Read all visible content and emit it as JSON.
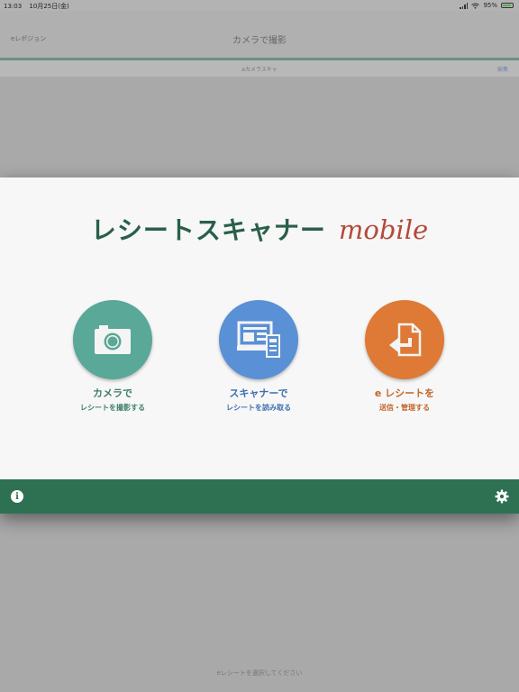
{
  "status_bar": {
    "time": "13:03",
    "date": "10月25日(金)",
    "battery": "95%"
  },
  "background": {
    "nav_back": "eレポジョン",
    "nav_title": "カメラで撮影",
    "sub_center": "eカメラスキャ",
    "sub_right": "編集",
    "footer_text": "eレシートを選択してください"
  },
  "modal": {
    "title_jp": "レシートスキャナー",
    "title_mobile": "mobile",
    "features": [
      {
        "line1": "カメラで",
        "line2": "レシートを撮影する",
        "icon": "camera-icon",
        "color": "#5aa897",
        "text_color": "#3f7d6c"
      },
      {
        "line1": "スキャナーで",
        "line2": "レシートを読み取る",
        "icon": "scanner-icon",
        "color": "#5a90d6",
        "text_color": "#3c6fb0"
      },
      {
        "line1": "e レシートを",
        "line2": "送信・管理する",
        "icon": "send-document-icon",
        "color": "#de7a35",
        "text_color": "#c2652a"
      }
    ]
  },
  "bottom_bar": {
    "color": "#2e7152",
    "left_icon": "info-icon",
    "right_icon": "gear-icon"
  }
}
